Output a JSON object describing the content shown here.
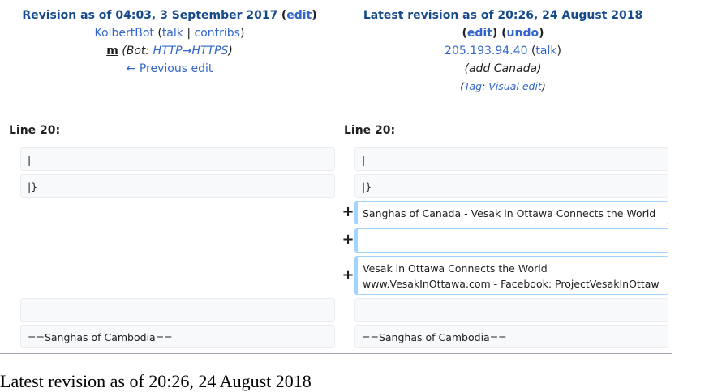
{
  "old_revision": {
    "title_text": "Revision as of 04:03, 3 September 2017",
    "edit_label": "edit",
    "user": "KolbertBot",
    "talk_label": "talk",
    "contribs_label": "contribs",
    "minor_mark": "m",
    "summary_prefix": "Bot: ",
    "summary_link": "HTTP→HTTPS",
    "prev_link": "← Previous edit"
  },
  "new_revision": {
    "title_text": "Latest revision as of 20:26, 24 August 2018",
    "edit_label": "edit",
    "undo_label": "undo",
    "user": "205.193.94.40",
    "talk_label": "talk",
    "summary": "(add Canada)",
    "tag_prefix": "Tag",
    "tag_name": "Visual edit"
  },
  "diff": {
    "left_line_label": "Line 20:",
    "right_line_label": "Line 20:",
    "context_1_left": "|",
    "context_1_right": "|",
    "context_2_left": "|}",
    "context_2_right": "|}",
    "added_1": "Sanghas of Canada - Vesak in Ottawa Connects the World",
    "added_2": "",
    "added_3": "Vesak in Ottawa Connects the World\nwww.VesakInOttawa.com - Facebook: ProjectVesakInOttaw",
    "context_3_left": "",
    "context_3_right": "",
    "context_4_left": "==Sanghas of Cambodia==",
    "context_4_right": "==Sanghas of Cambodia=="
  },
  "bottom_heading": "Latest revision as of 20:26, 24 August 2018"
}
